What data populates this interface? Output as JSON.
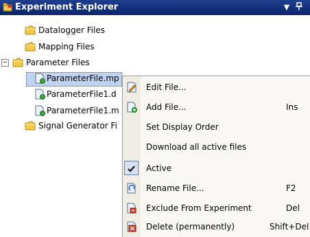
{
  "title": "Experiment Explorer",
  "titlebar_buttons": {
    "dropdown": "▼",
    "pin": "ꟷ"
  },
  "tree": {
    "items": [
      {
        "label": "Datalogger Files",
        "icon": "folder-icon"
      },
      {
        "label": "Mapping Files",
        "icon": "folder-icon"
      },
      {
        "label": "Parameter Files",
        "icon": "folder-icon",
        "expander": "−"
      },
      {
        "label": "ParameterFile.mp",
        "icon": "parameter-file-icon",
        "selected": true
      },
      {
        "label": "ParameterFile1.d",
        "icon": "parameter-file-icon"
      },
      {
        "label": "ParameterFile1.m",
        "icon": "parameter-file-icon"
      },
      {
        "label": "Signal Generator Fi",
        "icon": "folder-icon"
      }
    ]
  },
  "context_menu": {
    "items": [
      {
        "label": "Edit File...",
        "shortcut": "",
        "icon": "edit-file-icon"
      },
      {
        "label": "Add File...",
        "shortcut": "Ins",
        "icon": "add-file-icon"
      },
      {
        "label": "Set Display Order",
        "shortcut": "",
        "icon": ""
      },
      {
        "label": "Download all active files",
        "shortcut": "",
        "icon": ""
      },
      {
        "label": "Active",
        "shortcut": "",
        "icon": "checkmark-icon",
        "checked": true
      },
      {
        "label": "Rename File...",
        "shortcut": "F2",
        "icon": "rename-file-icon"
      },
      {
        "label": "Exclude From Experiment",
        "shortcut": "Del",
        "icon": "exclude-icon"
      },
      {
        "label": "Delete (permanently)",
        "shortcut": "Shift+Del",
        "icon": "delete-icon"
      }
    ]
  },
  "colors": {
    "titlebar": "#0a246a",
    "selection": "#c1d2ee",
    "menu_background": "#f9f8f4",
    "menu_gutter": "#efede4",
    "folder": "#f2c94c"
  }
}
